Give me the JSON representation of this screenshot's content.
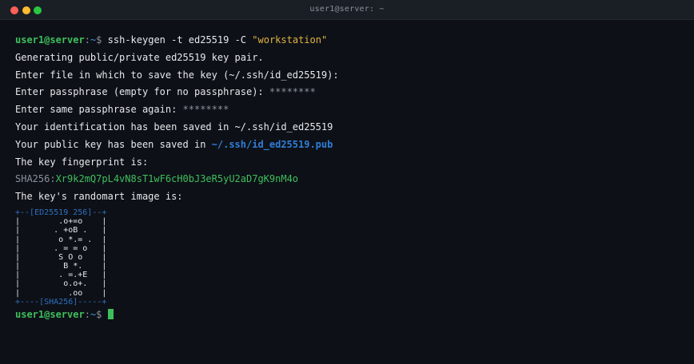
{
  "window": {
    "title": "user1@server: ~"
  },
  "prompt": {
    "user_host": "user1@server",
    "sep": ":",
    "path": "~",
    "symbol": "$"
  },
  "command": {
    "text": "ssh-keygen -t ed25519 -C ",
    "comment": "\"workstation\""
  },
  "output": {
    "l1": "Generating public/private ed25519 key pair.",
    "l2": "Enter file in which to save the key (~/.ssh/id_ed25519):",
    "l3_text": "Enter passphrase (empty for no passphrase): ",
    "l3_mask": "********",
    "l4_text": "Enter same passphrase again: ",
    "l4_mask": "********",
    "l5": "Your identification has been saved in ~/.ssh/id_ed25519",
    "l6_text": "Your public key has been saved in ",
    "l6_path": "~/.ssh/id_ed25519.pub",
    "l7": "The key fingerprint is:",
    "fp_label": "SHA256:",
    "fp_value": "Xr9k2mQ7pL4vN8sT1wF6cH0bJ3eR5yU2aD7gK9nM4o",
    "l8": "The key's randomart image is:"
  },
  "randomart": {
    "top": "+--[ED25519 256]--+",
    "rows": [
      "|        .o+=o    |",
      "|       . +oB .   |",
      "|        o *.= .  |",
      "|       . = = o   |",
      "|        S O o    |",
      "|         B *.    |",
      "|        . =.+E   |",
      "|         o.o+.   |",
      "|          .oo    |"
    ],
    "bottom": "+----[SHA256]-----+"
  },
  "colors": {
    "background": "#0d1117",
    "prompt_user": "#3fbf5c",
    "prompt_path": "#4f93d9",
    "string": "#e3b341",
    "link": "#2f7ed8",
    "hash": "#3fbf5c",
    "cursor": "#3fbf5c"
  }
}
